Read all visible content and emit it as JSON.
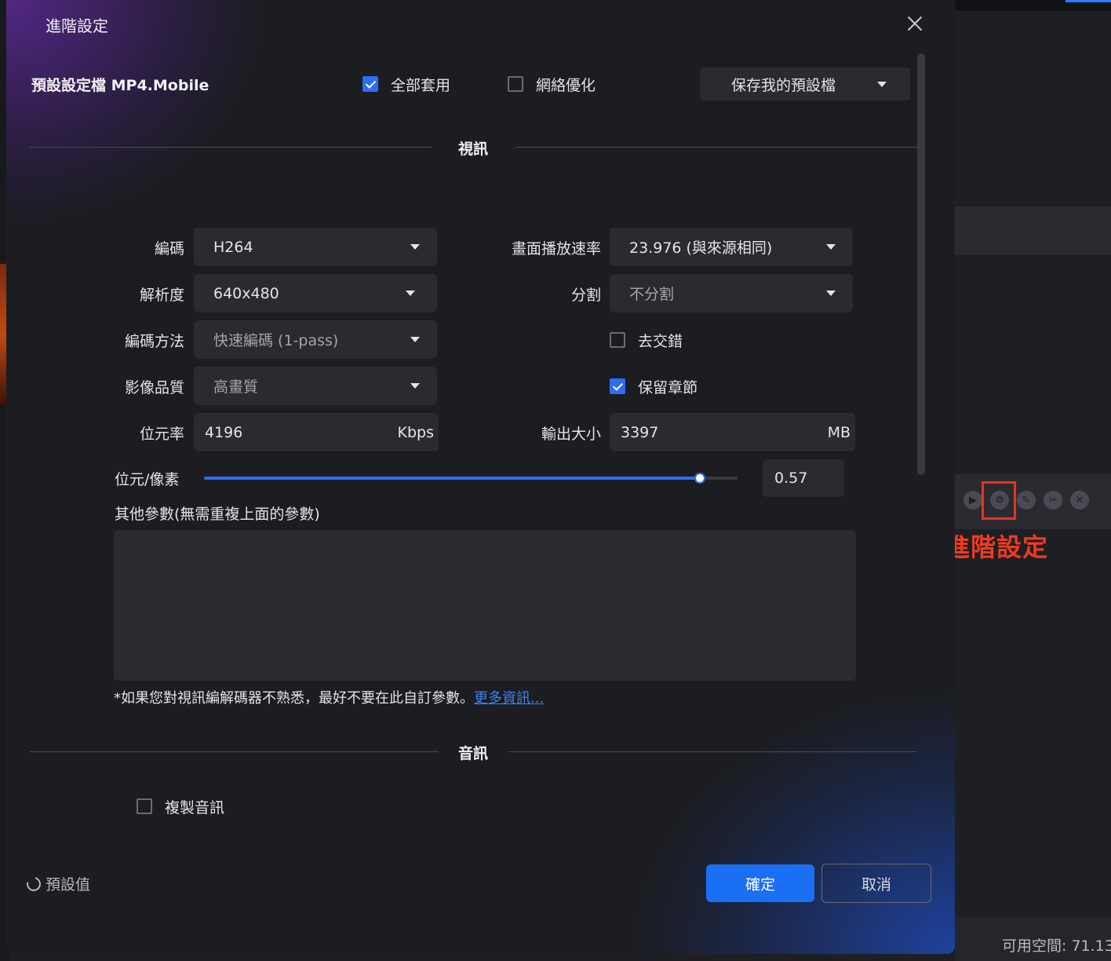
{
  "dialog": {
    "title": "進階設定",
    "preset_label": "預設設定檔 MP4.Mobile",
    "apply_all": {
      "label": "全部套用",
      "checked": true
    },
    "network_opt": {
      "label": "網絡優化",
      "checked": false
    },
    "save_preset": "保存我的預設檔"
  },
  "video": {
    "section_title": "視訊",
    "codec": {
      "label": "編碼",
      "value": "H264"
    },
    "resolution": {
      "label": "解析度",
      "value": "640x480"
    },
    "encode_method": {
      "label": "編碼方法",
      "value": "快速編碼 (1-pass)"
    },
    "quality": {
      "label": "影像品質",
      "value": "高畫質"
    },
    "bitrate": {
      "label": "位元率",
      "value": "4196",
      "unit": "Kbps"
    },
    "frame_rate": {
      "label": "畫面播放速率",
      "value": "23.976 (與來源相同)"
    },
    "split": {
      "label": "分割",
      "value": "不分割"
    },
    "deinterlace": {
      "label": "去交錯",
      "checked": false
    },
    "keep_chapters": {
      "label": "保留章節",
      "checked": true
    },
    "output_size": {
      "label": "輸出大小",
      "value": "3397",
      "unit": "MB"
    },
    "bits_per_pixel": {
      "label": "位元/像素",
      "value": "0.57",
      "fill_fraction": 0.93
    },
    "extra_params_label": "其他參數(無需重複上面的參數)",
    "note": "*如果您對視訊編解碼器不熟悉，最好不要在此自訂參數。",
    "more_info": "更多資訊..."
  },
  "audio": {
    "section_title": "音訊",
    "copy_audio": {
      "label": "複製音訊",
      "checked": false
    }
  },
  "footer": {
    "default": "預設值",
    "ok": "確定",
    "cancel": "取消"
  },
  "background": {
    "free_space": "可用空間: 71.13",
    "annotation": "進階設定"
  },
  "colors": {
    "accent": "#1a6ff5",
    "annotation": "#ef3b1d"
  }
}
